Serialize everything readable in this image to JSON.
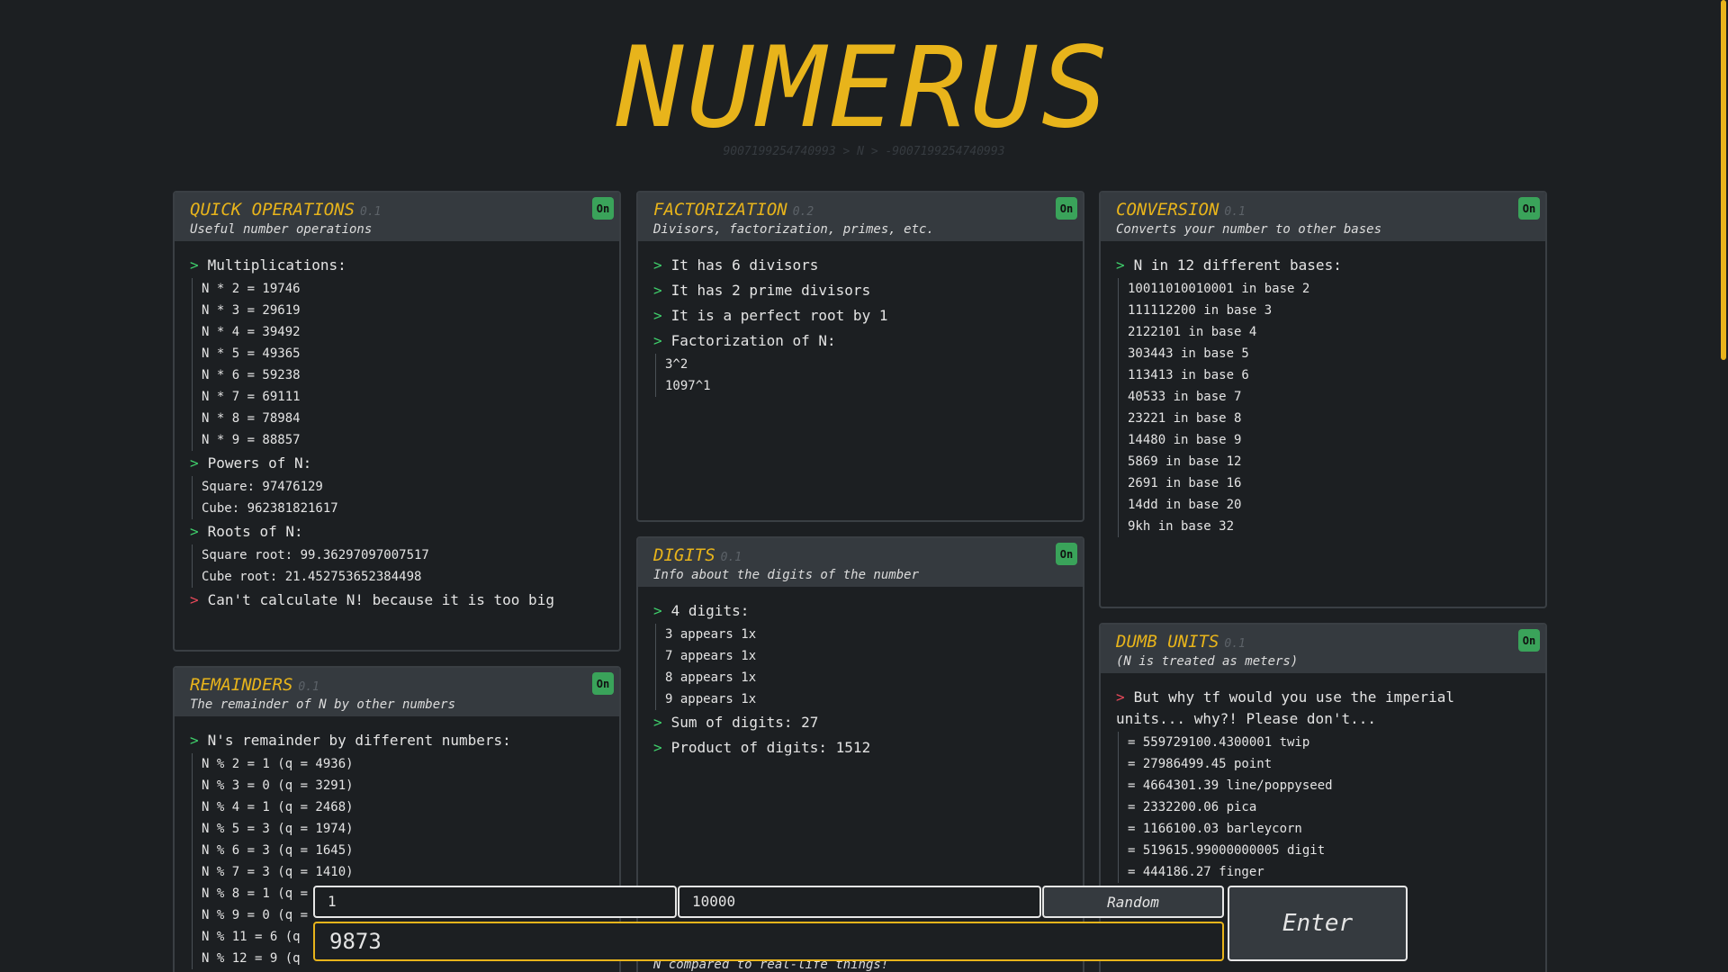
{
  "header": {
    "title": "NUMERUS",
    "subtitle": "9007199254740993 > N > -9007199254740993"
  },
  "cards": {
    "quick": {
      "title": "QUICK OPERATIONS",
      "version": "0.1",
      "desc": "Useful number operations",
      "badge": "On",
      "mult_head": "Multiplications:",
      "mult": [
        "N * 2 = 19746",
        "N * 3 = 29619",
        "N * 4 = 39492",
        "N * 5 = 49365",
        "N * 6 = 59238",
        "N * 7 = 69111",
        "N * 8 = 78984",
        "N * 9 = 88857"
      ],
      "powers_head": "Powers of N:",
      "powers": [
        "Square: 97476129",
        "Cube: 962381821617"
      ],
      "roots_head": "Roots of N:",
      "roots": [
        "Square root: 99.36297097007517",
        "Cube root: 21.452753652384498"
      ],
      "error": "Can't calculate N! because it is too big"
    },
    "remainders": {
      "title": "REMAINDERS",
      "version": "0.1",
      "desc": "The remainder of N by other numbers",
      "badge": "On",
      "head": "N's remainder by different numbers:",
      "items": [
        "N % 2 = 1 (q = 4936)",
        "N % 3 = 0 (q = 3291)",
        "N % 4 = 1 (q = 2468)",
        "N % 5 = 3 (q = 1974)",
        "N % 6 = 3 (q = 1645)",
        "N % 7 = 3 (q = 1410)",
        "N % 8 = 1 (q =",
        "N % 9 = 0 (q =",
        "N % 11 = 6 (q",
        "N % 12 = 9 (q"
      ]
    },
    "factorization": {
      "title": "FACTORIZATION",
      "version": "0.2",
      "desc": "Divisors, factorization, primes, etc.",
      "badge": "On",
      "l1": "It has 6 divisors",
      "l2": "It has 2 prime divisors",
      "l3": "It is a perfect root by 1",
      "l4": "Factorization of N:",
      "factors": [
        "3^2",
        "1097^1"
      ]
    },
    "digits": {
      "title": "DIGITS",
      "version": "0.1",
      "desc": "Info about the digits of the number",
      "badge": "On",
      "head": "4 digits:",
      "items": [
        "3 appears 1x",
        "7 appears 1x",
        "8 appears 1x",
        "9 appears 1x"
      ],
      "sum": "Sum of digits: 27",
      "product": "Product of digits: 1512",
      "tail": "N compared to real-life things!"
    },
    "conversion": {
      "title": "CONVERSION",
      "version": "0.1",
      "desc": "Converts your number to other bases",
      "badge": "On",
      "head": "N in 12 different bases:",
      "items": [
        "10011010010001 in base 2",
        "111112200 in base 3",
        "2122101 in base 4",
        "303443 in base 5",
        "113413 in base 6",
        "40533 in base 7",
        "23221 in base 8",
        "14480 in base 9",
        "5869 in base 12",
        "2691 in base 16",
        "14dd in base 20",
        "9kh in base 32"
      ]
    },
    "units": {
      "title": "DUMB UNITS",
      "version": "0.1",
      "desc": "(N is treated as meters)",
      "badge": "On",
      "warn": "But why tf would you use the imperial units... why?! Please don't...",
      "items": [
        "= 559729100.4300001 twip",
        "= 27986499.45 point",
        "= 4664301.39 line/poppyseed",
        "= 2332200.06 pica",
        "= 1166100.03 barleycorn",
        "= 519615.99000000005 digit",
        "= 444186.27 finger"
      ]
    }
  },
  "controls": {
    "min": "1",
    "max": "10000",
    "random_label": "Random",
    "number": "9873",
    "enter_label": "Enter"
  },
  "marker": ">"
}
